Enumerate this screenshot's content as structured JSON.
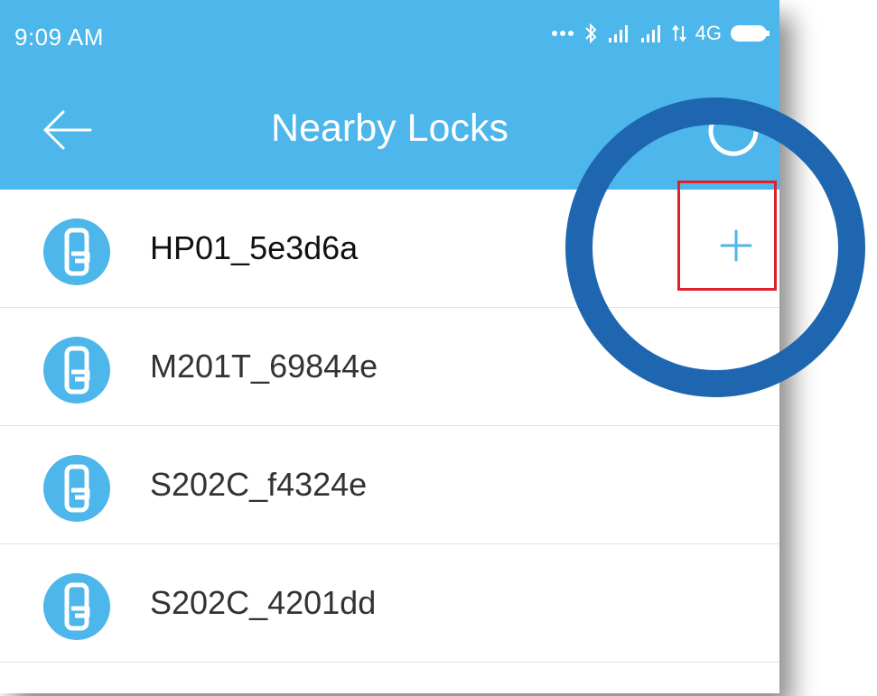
{
  "status_bar": {
    "time": "9:09 AM",
    "network": "4G"
  },
  "app_bar": {
    "title": "Nearby Locks",
    "back_icon": "arrow-left-icon",
    "refresh_icon": "loading-spinner-icon"
  },
  "locks": [
    {
      "name": "HP01_5e3d6a",
      "action": "+"
    },
    {
      "name": "M201T_69844e"
    },
    {
      "name": "S202C_f4324e"
    },
    {
      "name": "S202C_4201dd"
    }
  ],
  "colors": {
    "header": "#4db6ea",
    "accent": "#4db6ea",
    "highlight_ring": "#1e67b0",
    "highlight_box": "#e0212a"
  }
}
